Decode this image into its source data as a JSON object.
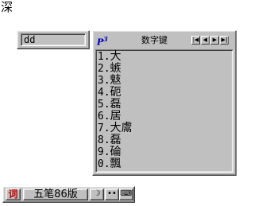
{
  "document": {
    "text": "深"
  },
  "composition": {
    "input": "dd"
  },
  "candidate_window": {
    "title": "数字键",
    "logo": "P",
    "logo_sup": "3",
    "nav": [
      "|◀",
      "◀",
      "▶",
      "▶|"
    ],
    "items": [
      {
        "num": "1.",
        "text": "大"
      },
      {
        "num": "2.",
        "text": "螏"
      },
      {
        "num": "3.",
        "text": "鬾"
      },
      {
        "num": "4.",
        "text": "砈"
      },
      {
        "num": "5.",
        "text": "磊"
      },
      {
        "num": "6.",
        "text": "居"
      },
      {
        "num": "7.",
        "text": "大鬳"
      },
      {
        "num": "8.",
        "text": "磊"
      },
      {
        "num": "9.",
        "text": "碖"
      },
      {
        "num": "0.",
        "text": "飄"
      }
    ]
  },
  "status_bar": {
    "cn_en": "词",
    "ime_name": "五笔86版",
    "moon": "☽",
    "punct": "••",
    "keyboard": "⌨"
  }
}
